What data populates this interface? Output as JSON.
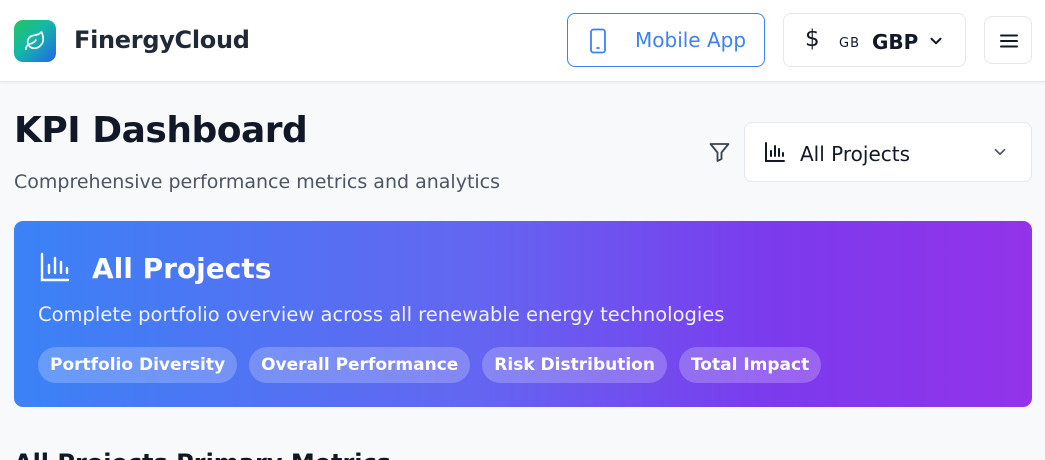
{
  "header": {
    "brand": "FinergyCloud",
    "mobile_app_label": "Mobile App",
    "currency": {
      "symbol": "$",
      "flag": "GB",
      "code": "GBP"
    }
  },
  "page": {
    "title": "KPI Dashboard",
    "subtitle": "Comprehensive performance metrics and analytics",
    "project_filter": {
      "selected": "All Projects"
    }
  },
  "banner": {
    "title": "All Projects",
    "description": "Complete portfolio overview across all renewable energy technologies",
    "tags": [
      "Portfolio Diversity",
      "Overall Performance",
      "Risk Distribution",
      "Total Impact"
    ]
  },
  "section": {
    "heading": "All Projects Primary Metrics"
  },
  "colors": {
    "accent": "#3b82f6",
    "banner_start": "#3b82f6",
    "banner_end": "#9333ea"
  }
}
